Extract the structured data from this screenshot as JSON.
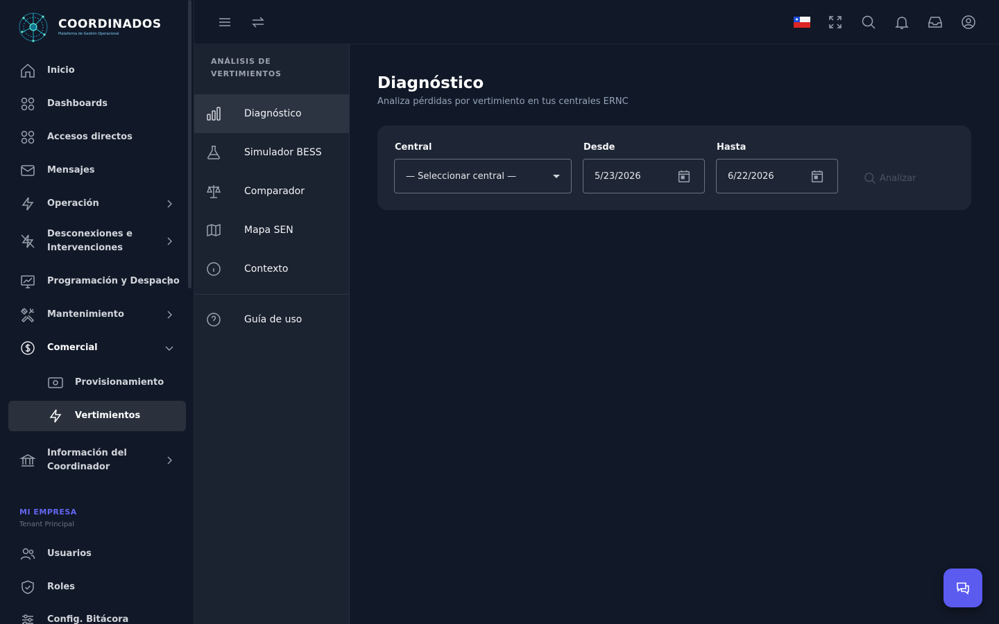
{
  "brand": {
    "name": "COORDINADOS",
    "tagline": "Plataforma de Gestión Operacional"
  },
  "sidebar": {
    "items": [
      {
        "label": "Inicio",
        "icon": "home-icon"
      },
      {
        "label": "Dashboards",
        "icon": "grid-icon"
      },
      {
        "label": "Accesos directos",
        "icon": "grid-icon"
      },
      {
        "label": "Mensajes",
        "icon": "mail-icon"
      },
      {
        "label": "Operación",
        "icon": "bolt-icon"
      },
      {
        "label": "Desconexiones e Intervenciones",
        "icon": "bolt-off-icon"
      },
      {
        "label": "Programación y Despacho",
        "icon": "chart-screen-icon"
      },
      {
        "label": "Mantenimiento",
        "icon": "tools-icon"
      },
      {
        "label": "Comercial",
        "icon": "dollar-icon"
      },
      {
        "label": "Provisionamiento",
        "icon": "cash-icon"
      },
      {
        "label": "Vertimientos",
        "icon": "bolt-icon"
      },
      {
        "label": "Información del Coordinador",
        "icon": "bank-icon"
      }
    ],
    "section": {
      "title": "MI EMPRESA",
      "subtitle": "Tenant Principal"
    },
    "section_items": [
      {
        "label": "Usuarios",
        "icon": "users-icon"
      },
      {
        "label": "Roles",
        "icon": "shield-icon"
      },
      {
        "label": "Config. Bitácora",
        "icon": "sliders-icon"
      }
    ]
  },
  "panel": {
    "title": "ANÁLISIS DE VERTIMIENTOS",
    "items": [
      {
        "label": "Diagnóstico",
        "icon": "bar-chart-icon"
      },
      {
        "label": "Simulador BESS",
        "icon": "flask-icon"
      },
      {
        "label": "Comparador",
        "icon": "scale-icon"
      },
      {
        "label": "Mapa SEN",
        "icon": "map-icon"
      },
      {
        "label": "Contexto",
        "icon": "info-icon"
      }
    ],
    "guide": {
      "label": "Guía de uso",
      "icon": "help-icon"
    }
  },
  "main": {
    "title": "Diagnóstico",
    "subtitle": "Analiza pérdidas por vertimiento en tus centrales ERNC",
    "form": {
      "central_label": "Central",
      "central_value": "— Seleccionar central —",
      "desde_label": "Desde",
      "desde_value": "5/23/2026",
      "hasta_label": "Hasta",
      "hasta_value": "6/22/2026",
      "analyze_label": "Analizar"
    }
  },
  "colors": {
    "accent": "#5b5bf0",
    "section_title": "#6366f1",
    "background": "#111827",
    "panel": "#1b2230",
    "card": "#1e2635"
  }
}
